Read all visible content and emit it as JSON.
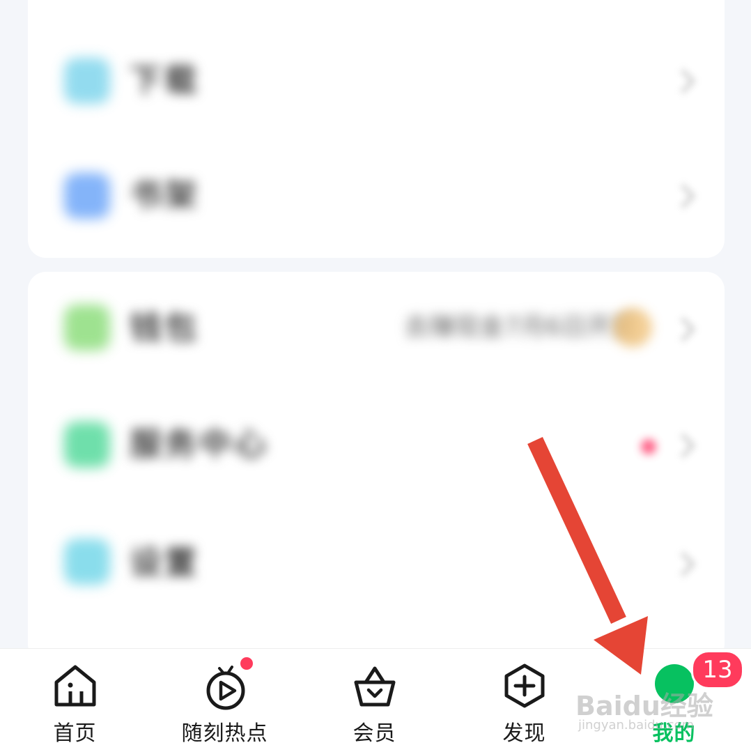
{
  "menu_card_1": {
    "rows": [
      {
        "label": "下载",
        "icon_color": "#6fd0ea"
      },
      {
        "label": "书架",
        "icon_color": "#5b9bf8"
      }
    ]
  },
  "menu_card_2": {
    "rows": [
      {
        "label": "钱包",
        "icon_color": "#7ed96b",
        "value": "去赚现金7月6日开奖"
      },
      {
        "label": "服务中心",
        "icon_color": "#3fd58f"
      },
      {
        "label": "设置",
        "icon_color": "#63d2e6"
      }
    ]
  },
  "tabbar": {
    "tabs": [
      {
        "label": "首页",
        "icon": "home-icon"
      },
      {
        "label": "随刻热点",
        "icon": "play-circle-icon"
      },
      {
        "label": "会员",
        "icon": "vip-basket-icon"
      },
      {
        "label": "发现",
        "icon": "plus-hexagon-icon"
      },
      {
        "label": "我的",
        "icon": "avatar-icon",
        "active": true
      }
    ],
    "badge_count": "13",
    "active_color": "#07c160",
    "badge_color": "#ff3b5c"
  },
  "watermark": {
    "main": "Baidu经验",
    "sub": "jingyan.baidu.com"
  },
  "annotation": {
    "arrow_color": "#e54535"
  }
}
